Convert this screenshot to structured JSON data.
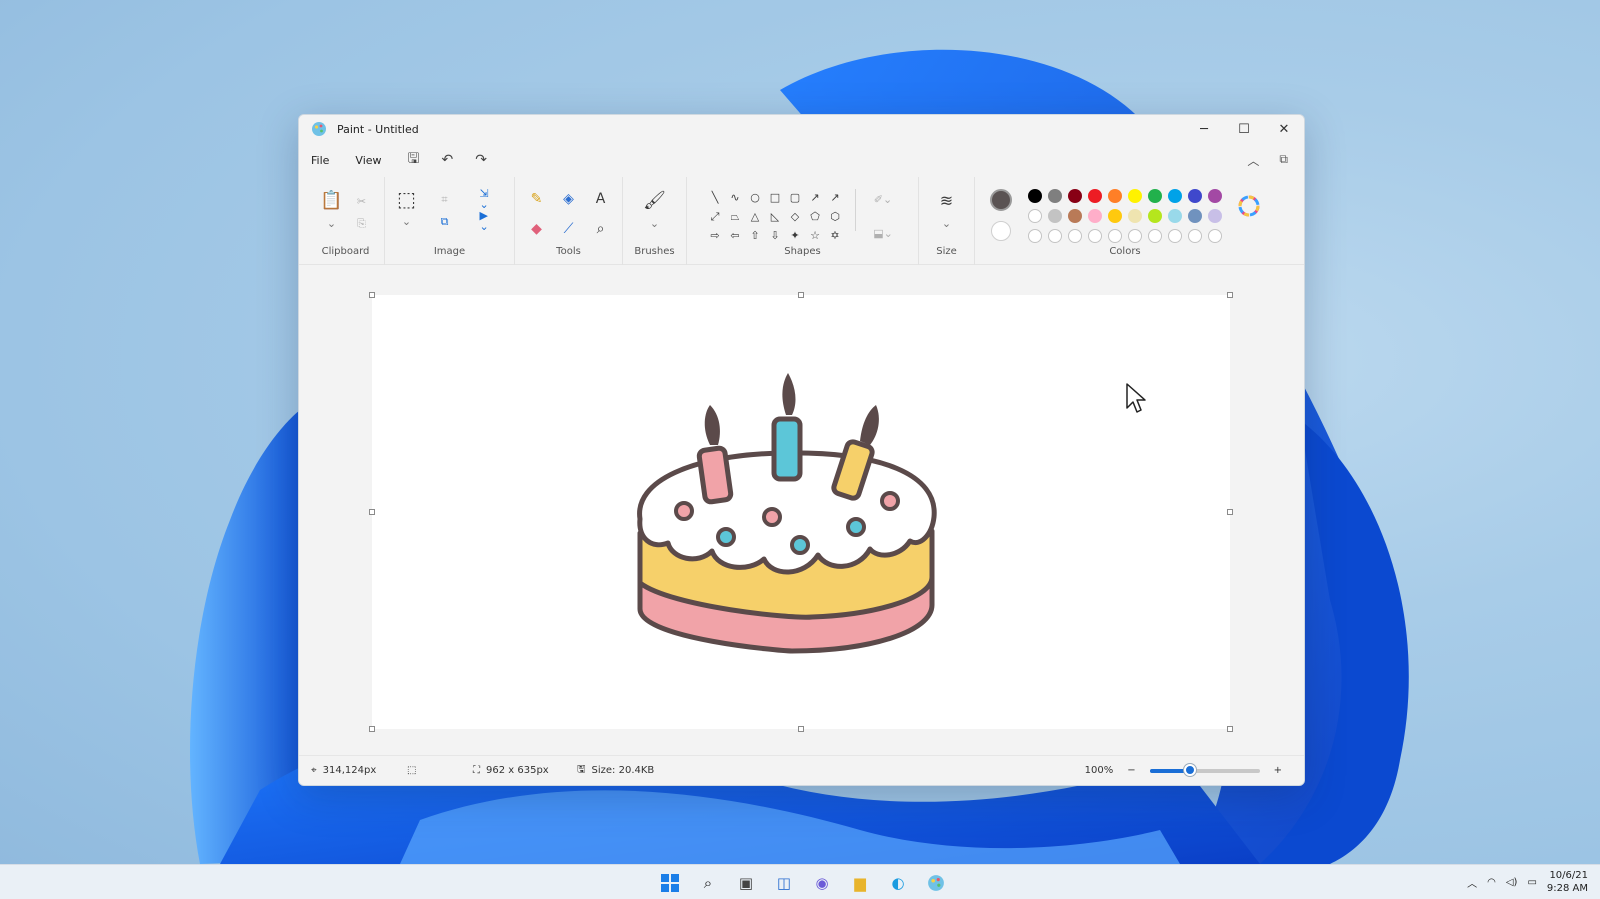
{
  "window": {
    "title": "Paint - Untitled",
    "controls": {
      "minimize": "─",
      "maximize": "☐",
      "close": "✕"
    }
  },
  "menu": {
    "file": "File",
    "view": "View"
  },
  "ribbon": {
    "groups": {
      "clipboard": "Clipboard",
      "image": "Image",
      "tools": "Tools",
      "brushes": "Brushes",
      "shapes": "Shapes",
      "size": "Size",
      "colors": "Colors"
    },
    "current_color": "#5a5353",
    "palette_row1": [
      "#000000",
      "#7f7f7f",
      "#880015",
      "#ed1c24",
      "#ff7f27",
      "#fff200",
      "#22b14c",
      "#00a2e8",
      "#3f48cc",
      "#a349a4"
    ],
    "palette_row2": [
      "#ffffff",
      "#c3c3c3",
      "#b97a57",
      "#ffaec9",
      "#ffc90e",
      "#efe4b0",
      "#b5e61d",
      "#99d9ea",
      "#7092be",
      "#c8bfe7"
    ]
  },
  "status": {
    "cursor_position": "314,124px",
    "canvas_size": "962 x 635px",
    "file_size": "Size: 20.4KB",
    "zoom": "100%",
    "zoom_fraction": 0.37
  },
  "taskbar": {
    "date": "10/6/21",
    "time": "9:28 AM"
  }
}
